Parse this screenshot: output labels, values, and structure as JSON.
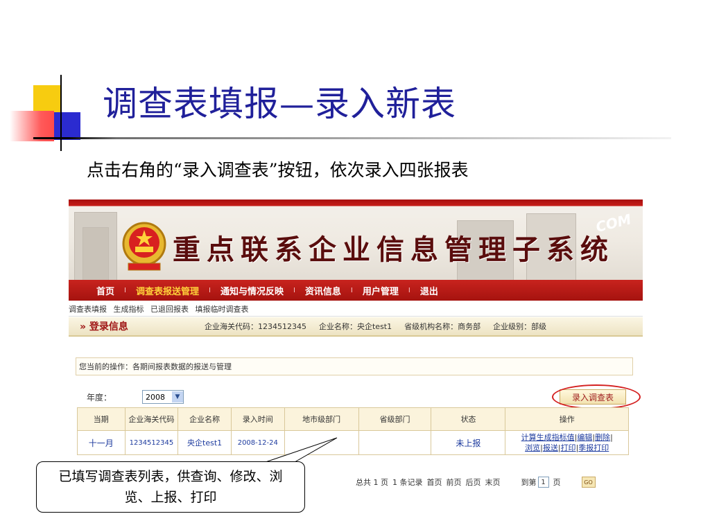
{
  "slide": {
    "title": "调查表填报—录入新表",
    "subtitle": "点击右角的“录入调查表”按钮，依次录入四张报表",
    "callout": "已填写调查表列表，供查询、修改、浏览、上报、打印"
  },
  "banner": {
    "system_title": "重点联系企业信息管理子系统",
    "watermark": "COM"
  },
  "nav": {
    "items": [
      {
        "label": "首页",
        "active": false
      },
      {
        "label": "调查表报送管理",
        "active": true
      },
      {
        "label": "通知与情况反映",
        "active": false
      },
      {
        "label": "资讯信息",
        "active": false
      },
      {
        "label": "用户管理",
        "active": false
      },
      {
        "label": "退出",
        "active": false
      }
    ],
    "separator": "I"
  },
  "subnav": [
    "调查表填报",
    "生成指标",
    "已退回报表",
    "填报临时调查表"
  ],
  "login": {
    "title": "» 登录信息",
    "customs_code": "企业海关代码：1234512345",
    "company_name": "企业名称：央企test1",
    "provincial_org": "省级机构名称：商务部",
    "company_level": "企业级别：部级"
  },
  "operation": "您当前的操作：各期间报表数据的报送与管理",
  "year": {
    "label": "年度：",
    "selected": "2008",
    "arrow": "▼"
  },
  "entry_button": "录入调查表",
  "table": {
    "headers": [
      "当期",
      "企业海关代码",
      "企业名称",
      "录入时间",
      "地市级部门",
      "省级部门",
      "状态",
      "操作"
    ],
    "rows": [
      {
        "period": "十一月",
        "code": "1234512345",
        "name": "央企test1",
        "time": "2008-12-24",
        "city_dept": "",
        "prov_dept": "",
        "status": "未上报",
        "actions_line1": [
          "计算生成指标值",
          "编辑",
          "删除"
        ],
        "actions_line2": [
          "浏览",
          "报送",
          "打印",
          "季报打印"
        ]
      }
    ]
  },
  "pager": {
    "total_pages": "总共 1 页",
    "total_records": "1 条记录",
    "first": "首页",
    "prev": "前页",
    "next": "后页",
    "last": "末页",
    "goto_prefix": "到第",
    "goto_value": "1",
    "goto_suffix": "页",
    "go": "GO"
  },
  "colors": {
    "title": "#20209a",
    "nav_red": "#b81a15",
    "accent_yellow": "#ffd23a",
    "ring_red": "#d42020"
  }
}
